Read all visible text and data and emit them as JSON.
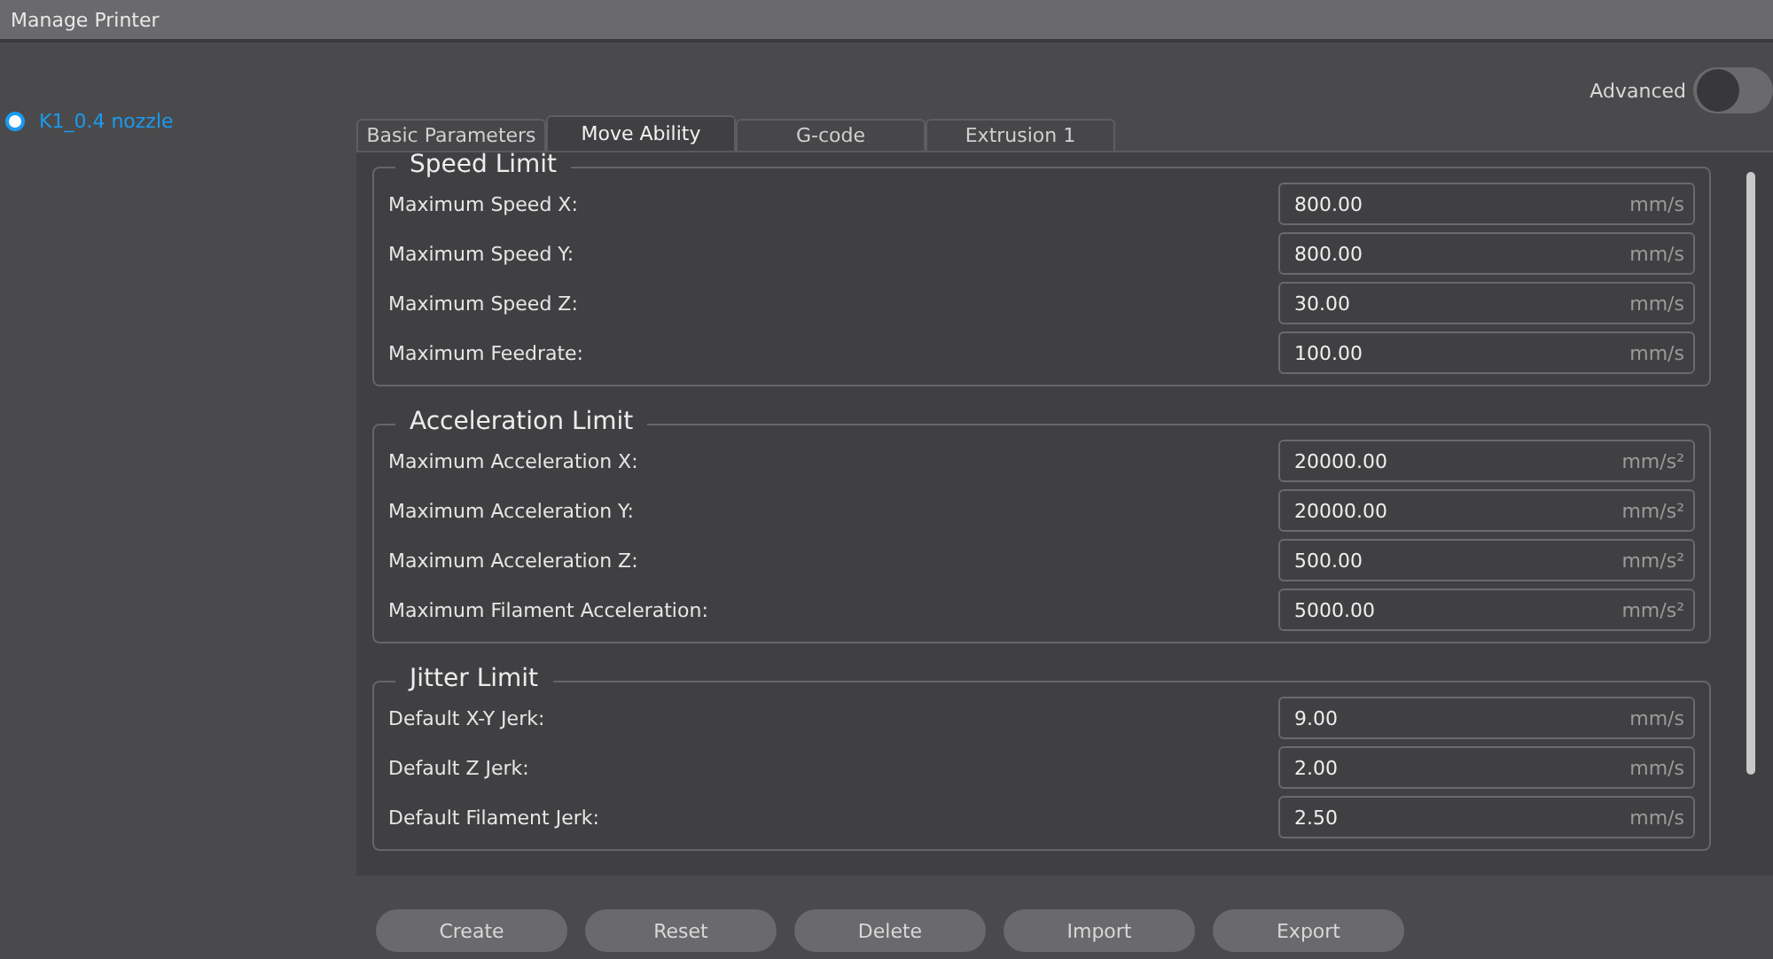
{
  "window": {
    "title": "Manage Printer"
  },
  "printers": [
    {
      "label": "K1_0.4 nozzle",
      "selected": true
    }
  ],
  "advanced": {
    "label": "Advanced",
    "on": false
  },
  "tabs": [
    {
      "label": "Basic Parameters",
      "selected": false
    },
    {
      "label": "Move Ability",
      "selected": true
    },
    {
      "label": "G-code",
      "selected": false
    },
    {
      "label": "Extrusion 1",
      "selected": false
    }
  ],
  "groups": [
    {
      "title": "Speed Limit",
      "rows": [
        {
          "label": "Maximum Speed X:",
          "value": "800.00",
          "unit": "mm/s"
        },
        {
          "label": "Maximum Speed Y:",
          "value": "800.00",
          "unit": "mm/s"
        },
        {
          "label": "Maximum Speed Z:",
          "value": "30.00",
          "unit": "mm/s"
        },
        {
          "label": "Maximum Feedrate:",
          "value": "100.00",
          "unit": "mm/s"
        }
      ]
    },
    {
      "title": "Acceleration Limit",
      "rows": [
        {
          "label": "Maximum Acceleration X:",
          "value": "20000.00",
          "unit": "mm/s²"
        },
        {
          "label": "Maximum Acceleration Y:",
          "value": "20000.00",
          "unit": "mm/s²"
        },
        {
          "label": "Maximum Acceleration Z:",
          "value": "500.00",
          "unit": "mm/s²"
        },
        {
          "label": "Maximum Filament Acceleration:",
          "value": "5000.00",
          "unit": "mm/s²"
        }
      ]
    },
    {
      "title": "Jitter Limit",
      "rows": [
        {
          "label": "Default X-Y Jerk:",
          "value": "9.00",
          "unit": "mm/s"
        },
        {
          "label": "Default Z Jerk:",
          "value": "2.00",
          "unit": "mm/s"
        },
        {
          "label": "Default Filament Jerk:",
          "value": "2.50",
          "unit": "mm/s"
        }
      ]
    }
  ],
  "buttons": [
    "Create",
    "Reset",
    "Delete",
    "Import",
    "Export"
  ]
}
